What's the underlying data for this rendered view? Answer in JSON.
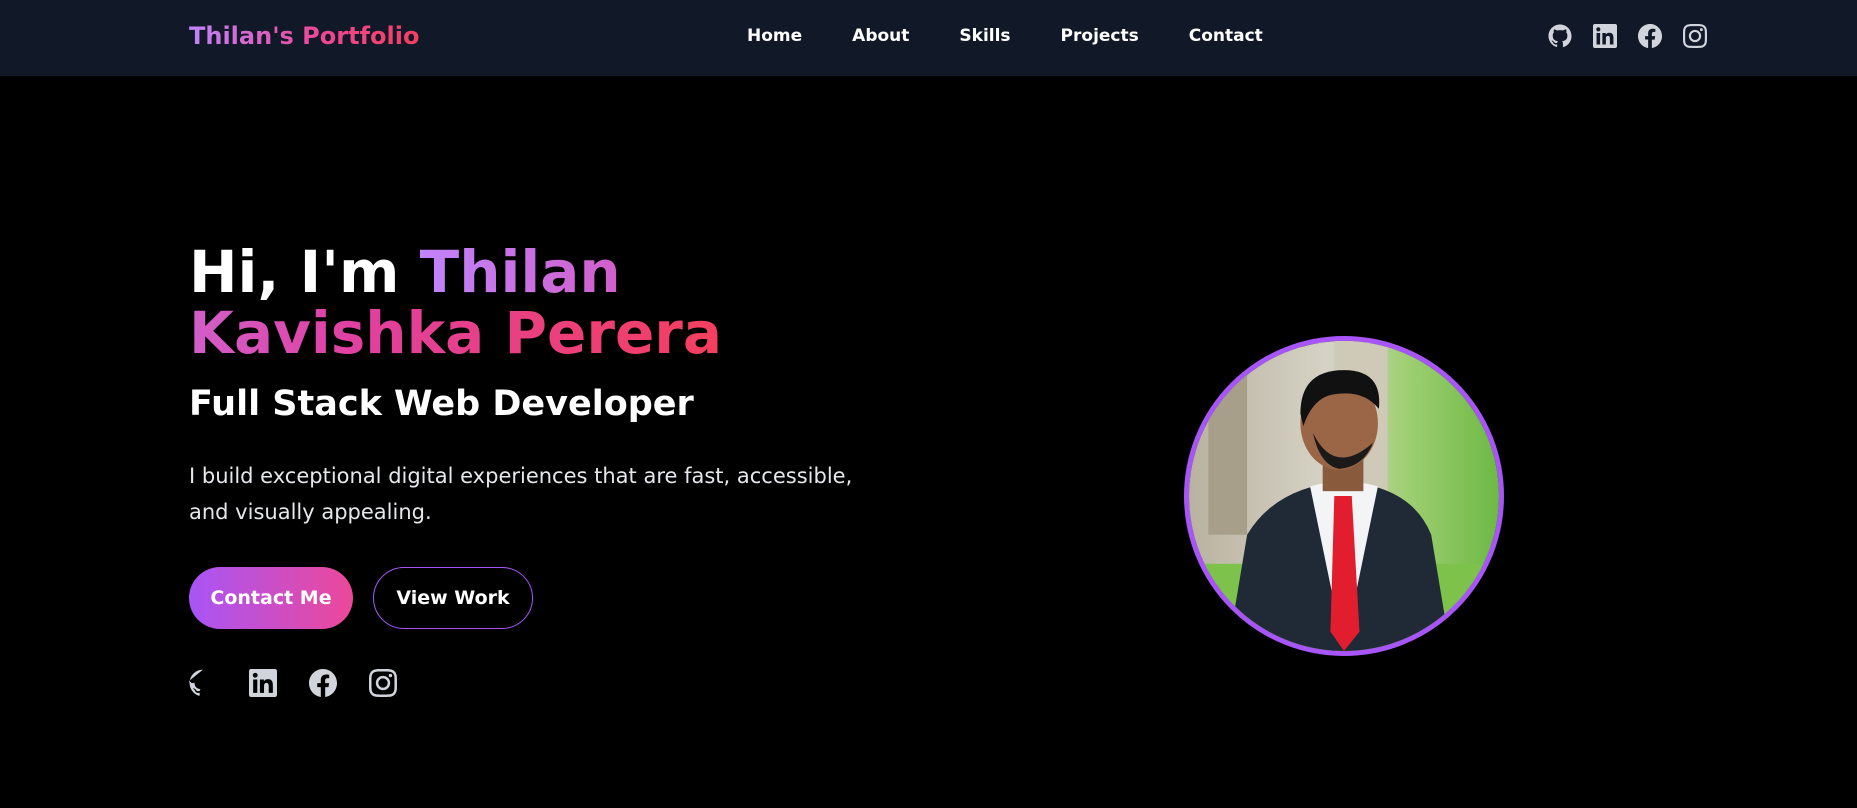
{
  "navbar": {
    "logo": "Thilan's Portfolio",
    "links": [
      {
        "label": "Home"
      },
      {
        "label": "About"
      },
      {
        "label": "Skills"
      },
      {
        "label": "Projects"
      },
      {
        "label": "Contact"
      }
    ],
    "social_icons": [
      "github-icon",
      "linkedin-icon",
      "facebook-icon",
      "instagram-icon"
    ]
  },
  "hero": {
    "greeting": "Hi, I'm ",
    "name": "Thilan Kavishka Perera",
    "subtitle": "Full Stack Web Developer",
    "description": "I build exceptional digital experiences that are fast, accessible, and visually appealing.",
    "primary_button": "Contact Me",
    "secondary_button": "View Work",
    "social_icons": [
      "github-icon",
      "linkedin-icon",
      "facebook-icon",
      "instagram-icon"
    ]
  },
  "colors": {
    "background": "#000000",
    "navbar_bg": "#111827",
    "accent_purple": "#a855f7",
    "accent_pink": "#ec4899",
    "accent_red": "#f43f5e"
  }
}
